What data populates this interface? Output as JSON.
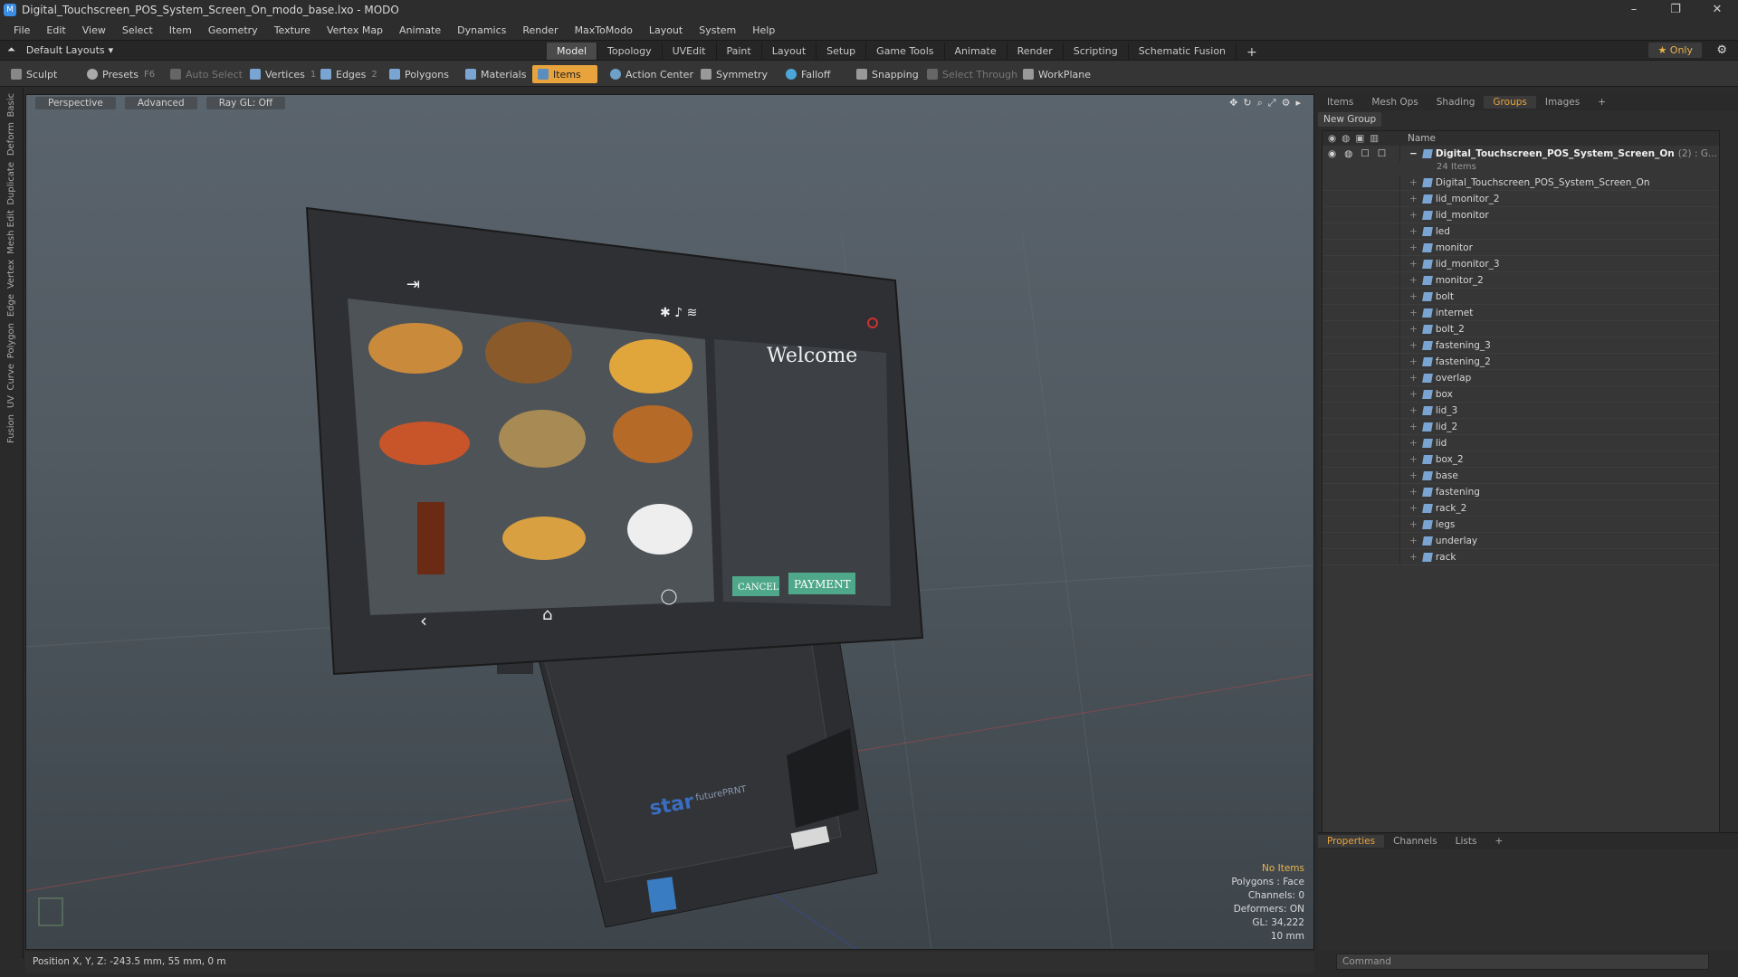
{
  "window": {
    "title": "Digital_Touchscreen_POS_System_Screen_On_modo_base.lxo - MODO"
  },
  "menu": [
    "File",
    "Edit",
    "View",
    "Select",
    "Item",
    "Geometry",
    "Texture",
    "Vertex Map",
    "Animate",
    "Dynamics",
    "Render",
    "MaxToModo",
    "Layout",
    "System",
    "Help"
  ],
  "layout": {
    "name": "Default Layouts"
  },
  "main_tabs": [
    "Model",
    "Topology",
    "UVEdit",
    "Paint",
    "Layout",
    "Setup",
    "Game Tools",
    "Animate",
    "Render",
    "Scripting",
    "Schematic Fusion"
  ],
  "only_label": "Only",
  "toolbar": {
    "sculpt": "Sculpt",
    "presets": "Presets",
    "presets_key": "F6",
    "auto_select": "Auto Select",
    "vertices": "Vertices",
    "vertices_key": "1",
    "edges": "Edges",
    "edges_key": "2",
    "polygons": "Polygons",
    "materials": "Materials",
    "items": "Items",
    "action_center": "Action Center",
    "symmetry": "Symmetry",
    "falloff": "Falloff",
    "snapping": "Snapping",
    "select_through": "Select Through",
    "workplane": "WorkPlane"
  },
  "left_tabs": [
    "Basic",
    "Deform",
    "Duplicate",
    "Mesh Edit",
    "Vertex",
    "Edge",
    "Polygon",
    "Curve",
    "UV",
    "Fusion"
  ],
  "viewport": {
    "perspective": "Perspective",
    "advanced": "Advanced",
    "raygl": "Ray GL: Off",
    "info": [
      "No Items",
      "Polygons : Face",
      "Channels: 0",
      "Deformers: ON",
      "GL: 34,222",
      "10 mm"
    ],
    "screen_welcome": "Welcome",
    "screen_cancel": "CANCEL",
    "screen_payment": "PAYMENT",
    "printer_brand": "star",
    "printer_line": "futurePRNT"
  },
  "status": {
    "position": "Position X, Y, Z:  -243.5 mm, 55 mm, 0 m"
  },
  "right_tabs": [
    "Items",
    "Mesh Ops",
    "Shading",
    "Groups",
    "Images"
  ],
  "new_group": "New Group",
  "tree": {
    "header": "Name",
    "group": "Digital_Touchscreen_POS_System_Screen_On",
    "group_count": "(2) : G...",
    "subcount": "24 Items",
    "items": [
      "Digital_Touchscreen_POS_System_Screen_On",
      "lid_monitor_2",
      "lid_monitor",
      "led",
      "monitor",
      "lid_monitor_3",
      "monitor_2",
      "bolt",
      "internet",
      "bolt_2",
      "fastening_3",
      "fastening_2",
      "overlap",
      "box",
      "lid_3",
      "lid_2",
      "lid",
      "box_2",
      "base",
      "fastening",
      "rack_2",
      "legs",
      "underlay",
      "rack"
    ]
  },
  "bottom_tabs": [
    "Properties",
    "Channels",
    "Lists"
  ],
  "command_placeholder": "Command",
  "colors": {
    "accent": "#e8a33c",
    "panel": "#2d2d2d",
    "viewport": "#525a62"
  }
}
